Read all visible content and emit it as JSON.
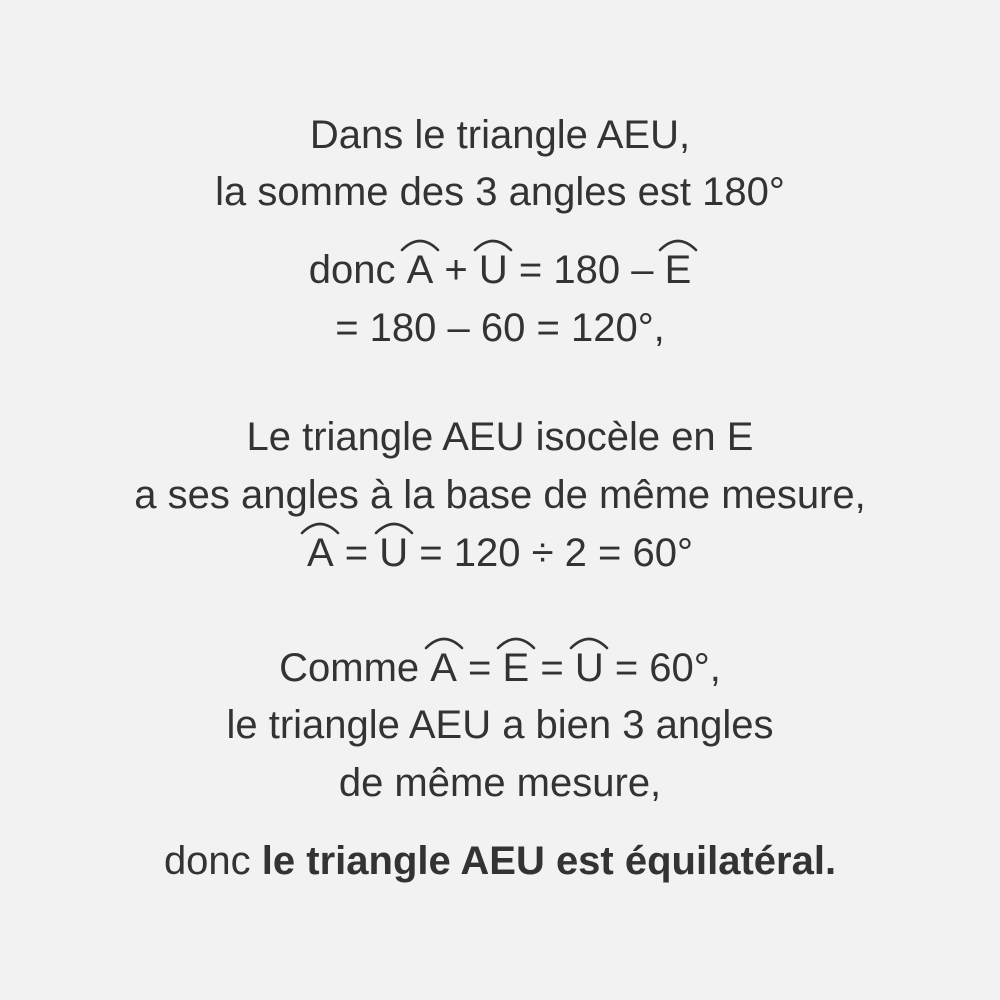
{
  "paragraph1": {
    "line1": "Dans le triangle AEU,",
    "line2": "la somme des 3 angles est 180°",
    "line3": {
      "lead": "donc ",
      "a": "A",
      "op1": " + ",
      "u": "U",
      "mid": " = 180 – ",
      "e": "E"
    },
    "line4": "= 180 – 60 = 120°,"
  },
  "paragraph2": {
    "line1": "Le triangle AEU isocèle en E",
    "line2": "a ses angles à la base de même mesure,",
    "line3": {
      "a": "A",
      "op1": " = ",
      "u": "U",
      "rest": " = 120 ÷ 2 = 60°"
    }
  },
  "paragraph3": {
    "line1": {
      "lead": "Comme ",
      "a": "A",
      "op1": " = ",
      "e": "E",
      "op2": " = ",
      "u": "U",
      "rest": " = 60°,"
    },
    "line2": "le triangle AEU a bien 3 angles",
    "line3": "de même mesure,"
  },
  "conclusion": {
    "lead": "donc ",
    "bold": "le triangle AEU est équilatéral."
  }
}
